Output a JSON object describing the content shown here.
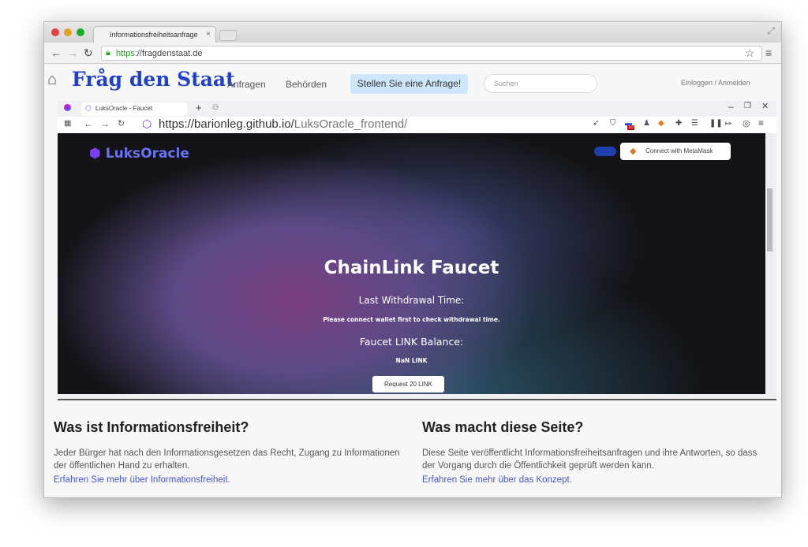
{
  "outer_browser": {
    "tab_title": "Informationsfreiheitsanfrage",
    "url_scheme": "https",
    "url_rest": "://fragdenstaat.de"
  },
  "fds": {
    "title": "Fråg den Staat",
    "nav": [
      "Anfragen",
      "Behörden"
    ],
    "cta": "Stellen Sie eine Anfrage!",
    "search_placeholder": "Suchen",
    "login": "Einloggen / Anmelden",
    "sections": [
      {
        "heading": "Was ist Informationsfreiheit?",
        "text": "Jeder Bürger hat nach den Informationsgesetzen das Recht, Zugang zu Informationen der öffentlichen Hand zu erhalten.",
        "link": "Erfahren Sie mehr über Informationsfreiheit."
      },
      {
        "heading": "Was macht diese Seite?",
        "text": "Diese Seite veröffentlicht Informationsfreiheitsanfragen und ihre Antworten, so dass der Vorgang durch die Öffentlichkeit geprüft werden kann.",
        "link": "Erfahren Sie mehr über das Konzept."
      }
    ]
  },
  "inner_browser": {
    "tab_title": "LuksOracle - Faucet",
    "url_host": "https://barionleg.github.io/",
    "url_path": "LuksOracle_frontend/",
    "badge": "10"
  },
  "app": {
    "logo": "LuksOracle",
    "connect": "Connect with MetaMask",
    "title": "ChainLink Faucet",
    "last_label": "Last Withdrawal Time:",
    "last_value": "Please connect wallet first to check withdrawal time.",
    "balance_label": "Faucet LINK Balance:",
    "balance_value": "NaN LINK",
    "request": "Request 20 LINK"
  }
}
